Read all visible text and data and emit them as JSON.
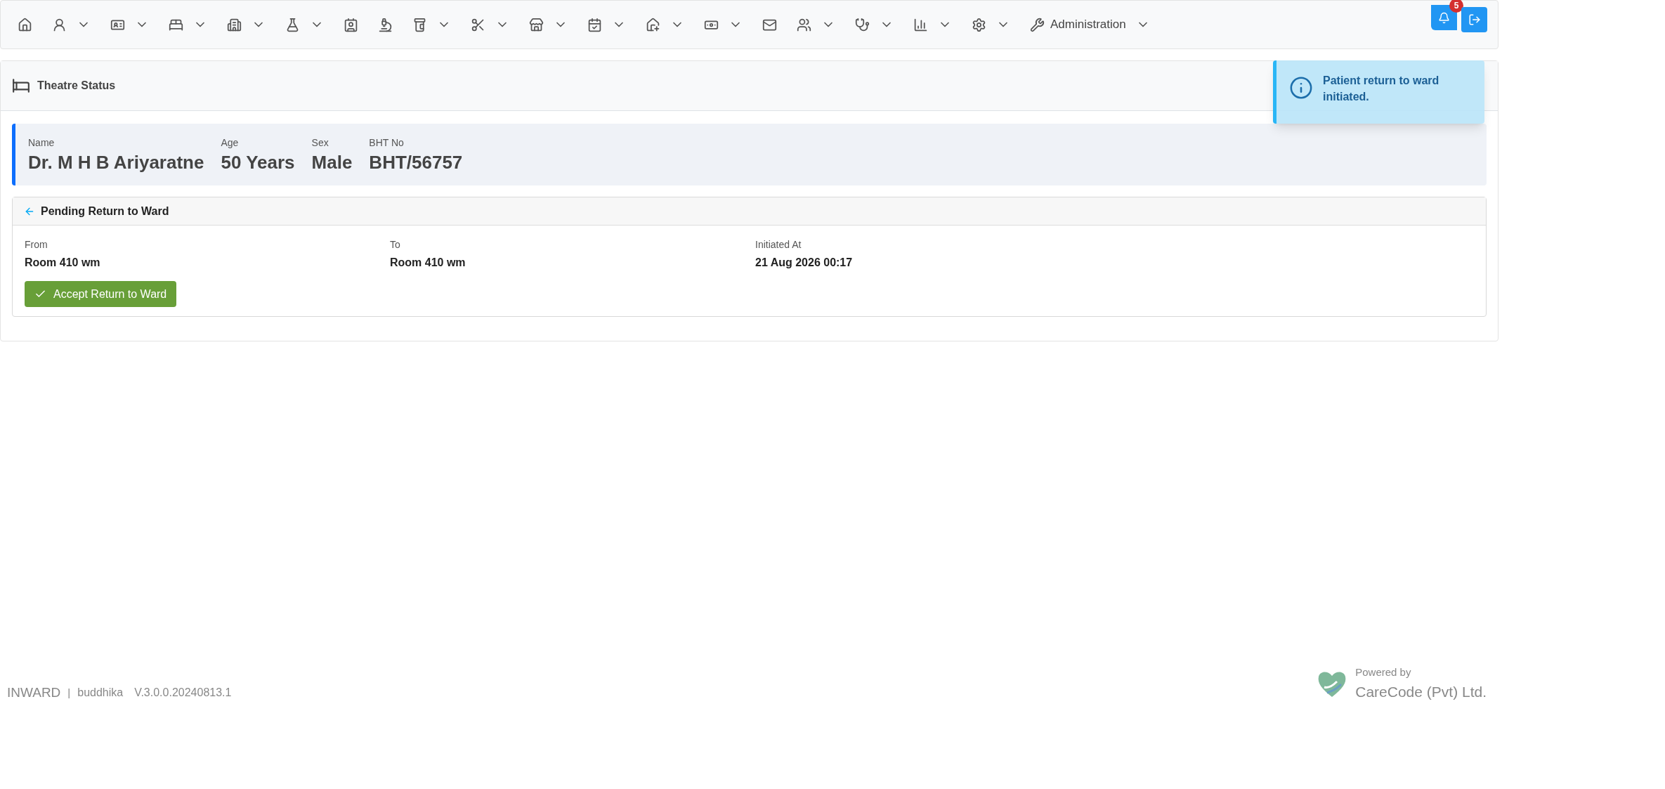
{
  "nav": {
    "items": [
      {
        "dropdown": false
      },
      {
        "dropdown": true
      },
      {
        "dropdown": true
      },
      {
        "dropdown": true
      },
      {
        "dropdown": true
      },
      {
        "dropdown": true
      },
      {
        "dropdown": false
      },
      {
        "dropdown": false
      },
      {
        "dropdown": true
      },
      {
        "dropdown": true
      },
      {
        "dropdown": true
      },
      {
        "dropdown": true
      },
      {
        "dropdown": true
      },
      {
        "dropdown": true
      },
      {
        "dropdown": false
      },
      {
        "dropdown": true
      },
      {
        "dropdown": true
      },
      {
        "dropdown": true
      },
      {
        "dropdown": true
      },
      {
        "dropdown": true,
        "label": "Administration"
      }
    ],
    "notifications_badge": "5"
  },
  "toast": {
    "message": "Patient return to ward initiated."
  },
  "panel": {
    "title": "Theatre Status"
  },
  "patient": [
    {
      "label": "Name",
      "value": "Dr. M H B Ariyaratne"
    },
    {
      "label": "Age",
      "value": "50 Years"
    },
    {
      "label": "Sex",
      "value": "Male"
    },
    {
      "label": "BHT No",
      "value": "BHT/56757"
    }
  ],
  "pending": {
    "title": "Pending Return to Ward",
    "fields": [
      {
        "label": "From",
        "value": "Room 410 wm"
      },
      {
        "label": "To",
        "value": "Room 410 wm"
      },
      {
        "label": "Initiated At",
        "value": "21 Aug 2026 00:17"
      }
    ],
    "button": "Accept Return to Ward"
  },
  "footer": {
    "app": "INWARD",
    "separator": "|",
    "user": "buddhika",
    "version": "V.3.0.0.20240813.1",
    "powered_by": "Powered by",
    "company": "CareCode (Pvt) Ltd."
  }
}
